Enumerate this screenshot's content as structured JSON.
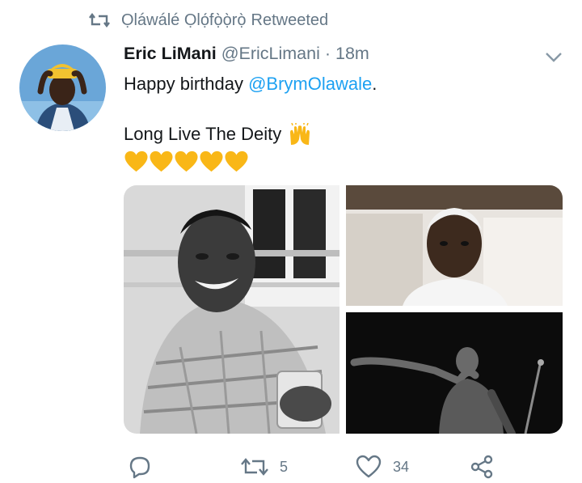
{
  "retweet_context": {
    "retweeter": "Ọláwálé  Ọlọ́fọ̀ọ̀rọ̀",
    "suffix": "Retweeted"
  },
  "author": {
    "name": "Eric LiMani",
    "handle": "@EricLimani",
    "separator": "·",
    "time": "18m"
  },
  "tweet": {
    "line1_prefix": "Happy birthday ",
    "mention": "@BrymOlawale",
    "line1_suffix": ".",
    "line2": "Long Live The Deity",
    "line2_emoji_icon": "raising-hands-icon",
    "hearts_icon": "yellow-heart-icon",
    "hearts_count": 5
  },
  "media": [
    {
      "icon": "photo-portrait-smiling-man"
    },
    {
      "icon": "photo-portrait-man-cap"
    },
    {
      "icon": "photo-stage-performer"
    }
  ],
  "actions": {
    "reply": {
      "icon": "reply-icon",
      "count": ""
    },
    "retweet": {
      "icon": "retweet-icon",
      "count": "5"
    },
    "like": {
      "icon": "heart-icon",
      "count": "34"
    },
    "share": {
      "icon": "share-icon"
    }
  },
  "colors": {
    "link": "#1da1f2",
    "muted": "#657786",
    "text": "#14171a",
    "heart": "#f9b717"
  }
}
